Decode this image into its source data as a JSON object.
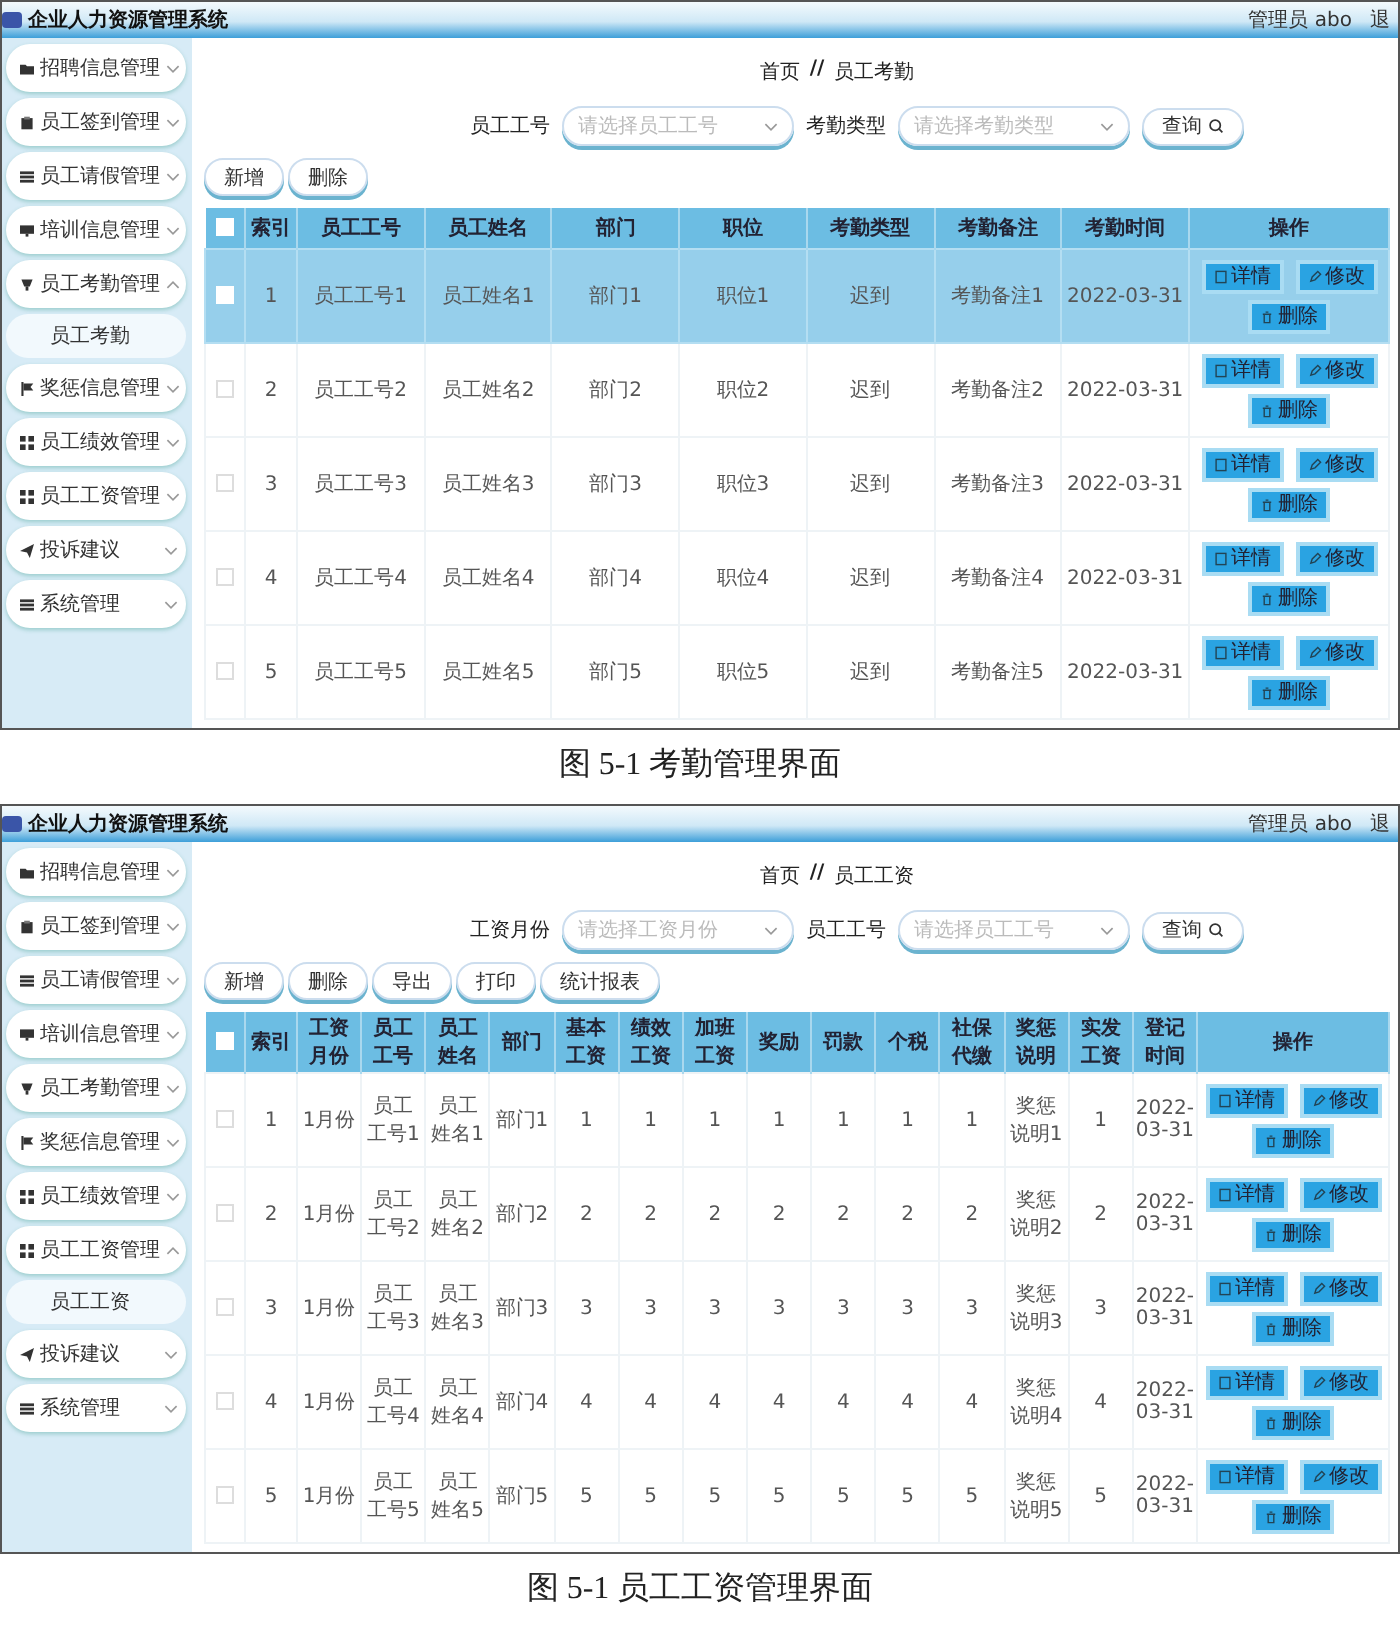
{
  "figures": [
    {
      "app": {
        "logo": "企业人力资源管理系统",
        "user": "管理员 abo",
        "logout": "退"
      },
      "sidebar": [
        {
          "label": "招聘信息管理",
          "expanded": false
        },
        {
          "label": "员工签到管理",
          "expanded": false
        },
        {
          "label": "员工请假管理",
          "expanded": false
        },
        {
          "label": "培训信息管理",
          "expanded": false
        },
        {
          "label": "员工考勤管理",
          "expanded": true,
          "children": [
            {
              "label": "员工考勤"
            }
          ]
        },
        {
          "label": "奖惩信息管理",
          "expanded": false
        },
        {
          "label": "员工绩效管理",
          "expanded": false
        },
        {
          "label": "员工工资管理",
          "expanded": false
        },
        {
          "label": "投诉建议",
          "expanded": false
        },
        {
          "label": "系统管理",
          "expanded": false
        }
      ],
      "breadcrumb": {
        "separator": "//",
        "items": [
          "首页",
          "员工考勤"
        ]
      },
      "filters": [
        {
          "label": "员工工号",
          "placeholder": "请选择员工工号"
        },
        {
          "label": "考勤类型",
          "placeholder": "请选择考勤类型"
        }
      ],
      "search_button": "查询",
      "actions": [
        "新增",
        "删除"
      ],
      "table": {
        "all_checked": false,
        "columns": [
          "索引",
          "员工工号",
          "员工姓名",
          "部门",
          "职位",
          "考勤类型",
          "考勤备注",
          "考勤时间",
          "操作"
        ],
        "rows": [
          {
            "selected": true,
            "checked": false,
            "cells": [
              "1",
              "员工工号1",
              "员工姓名1",
              "部门1",
              "职位1",
              "迟到",
              "考勤备注1",
              "2022-03-31"
            ],
            "actions": [
              "详情",
              "修改",
              "删除"
            ]
          },
          {
            "selected": false,
            "checked": false,
            "cells": [
              "2",
              "员工工号2",
              "员工姓名2",
              "部门2",
              "职位2",
              "迟到",
              "考勤备注2",
              "2022-03-31"
            ],
            "actions": [
              "详情",
              "修改",
              "删除"
            ]
          },
          {
            "selected": false,
            "checked": false,
            "cells": [
              "3",
              "员工工号3",
              "员工姓名3",
              "部门3",
              "职位3",
              "迟到",
              "考勤备注3",
              "2022-03-31"
            ],
            "actions": [
              "详情",
              "修改",
              "删除"
            ]
          },
          {
            "selected": false,
            "checked": false,
            "cells": [
              "4",
              "员工工号4",
              "员工姓名4",
              "部门4",
              "职位4",
              "迟到",
              "考勤备注4",
              "2022-03-31"
            ],
            "actions": [
              "详情",
              "修改",
              "删除"
            ]
          },
          {
            "selected": false,
            "checked": false,
            "cells": [
              "5",
              "员工工号5",
              "员工姓名5",
              "部门5",
              "职位5",
              "迟到",
              "考勤备注5",
              "2022-03-31"
            ],
            "actions": [
              "详情",
              "修改",
              "删除"
            ]
          }
        ]
      },
      "caption": "图 5-1 考勤管理界面"
    },
    {
      "app": {
        "logo": "企业人力资源管理系统",
        "user": "管理员 abo",
        "logout": "退"
      },
      "sidebar": [
        {
          "label": "招聘信息管理",
          "expanded": false
        },
        {
          "label": "员工签到管理",
          "expanded": false
        },
        {
          "label": "员工请假管理",
          "expanded": false
        },
        {
          "label": "培训信息管理",
          "expanded": false
        },
        {
          "label": "员工考勤管理",
          "expanded": false
        },
        {
          "label": "奖惩信息管理",
          "expanded": false
        },
        {
          "label": "员工绩效管理",
          "expanded": false
        },
        {
          "label": "员工工资管理",
          "expanded": true,
          "children": [
            {
              "label": "员工工资"
            }
          ]
        },
        {
          "label": "投诉建议",
          "expanded": false
        },
        {
          "label": "系统管理",
          "expanded": false
        }
      ],
      "breadcrumb": {
        "separator": "//",
        "items": [
          "首页",
          "员工工资"
        ]
      },
      "filters": [
        {
          "label": "工资月份",
          "placeholder": "请选择工资月份"
        },
        {
          "label": "员工工号",
          "placeholder": "请选择员工工号"
        }
      ],
      "search_button": "查询",
      "actions": [
        "新增",
        "删除",
        "导出",
        "打印",
        "统计报表"
      ],
      "table": {
        "all_checked": false,
        "columns": [
          "索引",
          "工资月份",
          "员工工号",
          "员工姓名",
          "部门",
          "基本工资",
          "绩效工资",
          "加班工资",
          "奖励",
          "罚款",
          "个税",
          "社保代缴",
          "奖惩说明",
          "实发工资",
          "登记时间",
          "操作"
        ],
        "rows": [
          {
            "selected": false,
            "checked": false,
            "cells": [
              "1",
              "1月份",
              "员工工号1",
              "员工姓名1",
              "部门1",
              "1",
              "1",
              "1",
              "1",
              "1",
              "1",
              "1",
              "奖惩说明1",
              "1",
              "2022-03-31"
            ],
            "actions": [
              "详情",
              "修改",
              "删除"
            ]
          },
          {
            "selected": false,
            "checked": false,
            "cells": [
              "2",
              "1月份",
              "员工工号2",
              "员工姓名2",
              "部门2",
              "2",
              "2",
              "2",
              "2",
              "2",
              "2",
              "2",
              "奖惩说明2",
              "2",
              "2022-03-31"
            ],
            "actions": [
              "详情",
              "修改",
              "删除"
            ]
          },
          {
            "selected": false,
            "checked": false,
            "cells": [
              "3",
              "1月份",
              "员工工号3",
              "员工姓名3",
              "部门3",
              "3",
              "3",
              "3",
              "3",
              "3",
              "3",
              "3",
              "奖惩说明3",
              "3",
              "2022-03-31"
            ],
            "actions": [
              "详情",
              "修改",
              "删除"
            ]
          },
          {
            "selected": false,
            "checked": false,
            "cells": [
              "4",
              "1月份",
              "员工工号4",
              "员工姓名4",
              "部门4",
              "4",
              "4",
              "4",
              "4",
              "4",
              "4",
              "4",
              "奖惩说明4",
              "4",
              "2022-03-31"
            ],
            "actions": [
              "详情",
              "修改",
              "删除"
            ]
          },
          {
            "selected": false,
            "checked": false,
            "cells": [
              "5",
              "1月份",
              "员工工号5",
              "员工姓名5",
              "部门5",
              "5",
              "5",
              "5",
              "5",
              "5",
              "5",
              "5",
              "奖惩说明5",
              "5",
              "2022-03-31"
            ],
            "actions": [
              "详情",
              "修改",
              "删除"
            ]
          }
        ]
      },
      "caption": "图 5-1 员工工资管理界面"
    }
  ]
}
